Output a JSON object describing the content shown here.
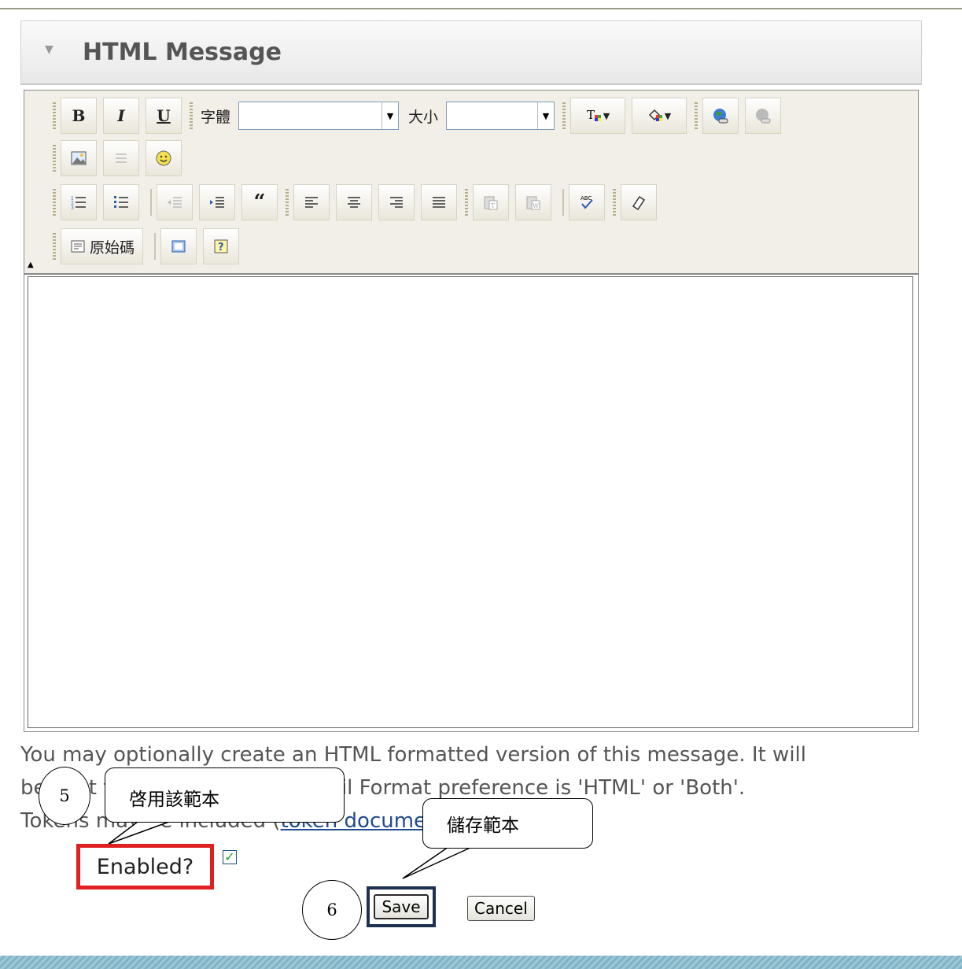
{
  "panel": {
    "title": "HTML Message"
  },
  "toolbar": {
    "bold": "B",
    "italic": "I",
    "underline": "U",
    "font_label": "字體",
    "font_value": "",
    "size_label": "大小",
    "size_value": "",
    "source_label": "原始碼"
  },
  "help_text": {
    "line1": "You may optionally create an HTML formatted version of this message. It will",
    "line2": "be sent to contacts whose Email Format preference is 'HTML' or 'Both'.",
    "line3_prefix": "Tokens may be included (",
    "link": "token documentation",
    "line3_suffix": ")."
  },
  "callouts": {
    "c5_number": "5",
    "c5_text": "啓用該範本",
    "c6_number": "6",
    "c6_text": "儲存範本"
  },
  "form": {
    "enabled_label": "Enabled?",
    "enabled_checked": true,
    "save_label": "Save",
    "cancel_label": "Cancel"
  }
}
